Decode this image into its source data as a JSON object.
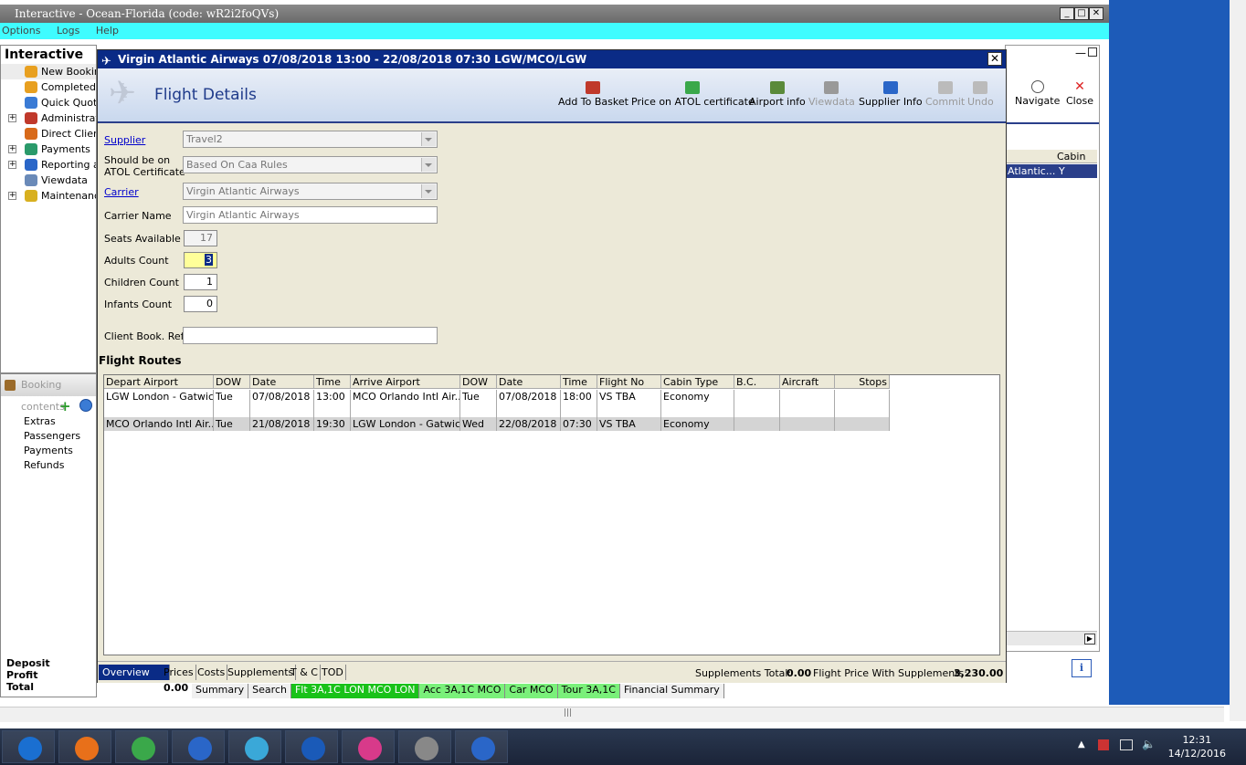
{
  "app": {
    "window_title": "Interactive - Ocean-Florida (code: wR2i2foQVs)",
    "menu": [
      "Options",
      "Logs",
      "Help"
    ],
    "pane_title": "Interactive"
  },
  "sidebar": {
    "items": [
      {
        "label": "New Booking",
        "icon": "palm-tree-icon",
        "expand": ""
      },
      {
        "label": "Completed B",
        "icon": "palm-tree-icon",
        "expand": ""
      },
      {
        "label": "Quick Quote",
        "icon": "globe-icon",
        "expand": ""
      },
      {
        "label": "Administrat",
        "icon": "person-icon",
        "expand": "+"
      },
      {
        "label": "Direct Client",
        "icon": "client-icon",
        "expand": ""
      },
      {
        "label": "Payments",
        "icon": "payments-icon",
        "expand": "+"
      },
      {
        "label": "Reporting ar",
        "icon": "report-icon",
        "expand": "+"
      },
      {
        "label": "Viewdata",
        "icon": "viewdata-icon",
        "expand": ""
      },
      {
        "label": "Maintenance",
        "icon": "maintenance-icon",
        "expand": "+"
      }
    ]
  },
  "booking_contents": {
    "title": "Booking contents",
    "items": [
      "Extras",
      "Passengers",
      "Payments",
      "Refunds"
    ]
  },
  "totals": {
    "deposit_label": "Deposit",
    "profit_label": "Profit",
    "total_label": "Total",
    "total_value": "0.00"
  },
  "bottom_tabs": [
    {
      "label": "Summary",
      "style": "plain"
    },
    {
      "label": "Search",
      "style": "plain"
    },
    {
      "label": "Flt 3A,1C LON MCO LON",
      "style": "green"
    },
    {
      "label": "Acc 3A,1C MCO",
      "style": "light"
    },
    {
      "label": "Car MCO",
      "style": "light"
    },
    {
      "label": "Tour 3A,1C",
      "style": "light"
    },
    {
      "label": "Financial Summary",
      "style": "plain"
    }
  ],
  "right_pane": {
    "navigate_label": "Navigate",
    "close_label": "Close",
    "col_cabin": "Cabin",
    "row_carrier": "Atlantic...",
    "row_cabin": "Y"
  },
  "dialog": {
    "title": "Virgin Atlantic Airways 07/08/2018 13:00 - 22/08/2018 07:30 LGW/MCO/LGW",
    "heading": "Flight Details",
    "toolbar": [
      {
        "label": "Add To Basket",
        "icon": "basket-icon",
        "enabled": true,
        "color": "#c0392b"
      },
      {
        "label": "Price on ATOL certificate",
        "icon": "money-icon",
        "enabled": true,
        "color": "#3aa84a"
      },
      {
        "label": "Airport info",
        "icon": "airport-icon",
        "enabled": true,
        "color": "#5a8a3a"
      },
      {
        "label": "Viewdata",
        "icon": "viewdata-icon",
        "enabled": false,
        "color": "#999999"
      },
      {
        "label": "Supplier Info",
        "icon": "supplier-icon",
        "enabled": true,
        "color": "#2a66c8"
      },
      {
        "label": "Commit",
        "icon": "commit-icon",
        "enabled": false,
        "color": "#bbbbbb"
      },
      {
        "label": "Undo",
        "icon": "undo-icon",
        "enabled": false,
        "color": "#bbbbbb"
      }
    ],
    "form": {
      "supplier_label": "Supplier",
      "supplier_value": "Travel2",
      "atol_label_1": "Should be on",
      "atol_label_2": "ATOL Certificate",
      "atol_value": "Based On Caa Rules",
      "carrier_label": "Carrier",
      "carrier_value": "Virgin Atlantic Airways",
      "carrier_name_label": "Carrier Name",
      "carrier_name_value": "Virgin Atlantic Airways",
      "seats_label": "Seats Available",
      "seats_value": "17",
      "adults_label": "Adults Count",
      "adults_value": "3",
      "children_label": "Children Count",
      "children_value": "1",
      "infants_label": "Infants Count",
      "infants_value": "0",
      "client_ref_label": "Client Book. Ref.",
      "client_ref_value": ""
    },
    "routes_title": "Flight Routes",
    "routes_columns": [
      "Depart Airport",
      "DOW",
      "Date",
      "Time",
      "Arrive Airport",
      "DOW",
      "Date",
      "Time",
      "Flight No",
      "Cabin Type",
      "B.C.",
      "Aircraft",
      "Stops"
    ],
    "routes_rows": [
      [
        "LGW London - Gatwic...",
        "Tue",
        "07/08/2018",
        "13:00",
        "MCO Orlando Intl Air...",
        "Tue",
        "07/08/2018",
        "18:00",
        "VS TBA",
        "Economy",
        "",
        "",
        ""
      ],
      [
        "",
        "",
        "",
        "",
        "",
        "",
        "",
        "",
        "",
        "",
        "",
        "",
        ""
      ],
      [
        "MCO Orlando Intl Air...",
        "Tue",
        "21/08/2018",
        "19:30",
        "LGW London - Gatwic...",
        "Wed",
        "22/08/2018",
        "07:30",
        "VS TBA",
        "Economy",
        "",
        "",
        ""
      ]
    ],
    "footer_tabs": [
      "Overview",
      "Prices",
      "Costs",
      "Supplements",
      "T & C",
      "TOD"
    ],
    "supplements_total_label": "Supplements Total:",
    "supplements_total_value": "0.00",
    "flight_price_label": "Flight Price With Supplements:",
    "flight_price_value": "3,230.00"
  },
  "taskbar": {
    "apps": [
      "outlook-icon",
      "firefox-icon",
      "chrome-icon",
      "remote-desktop-icon",
      "app-icon",
      "word-icon",
      "itunes-icon",
      "calculator-icon",
      "app-g-icon"
    ],
    "time": "12:31",
    "date": "14/12/2016"
  }
}
